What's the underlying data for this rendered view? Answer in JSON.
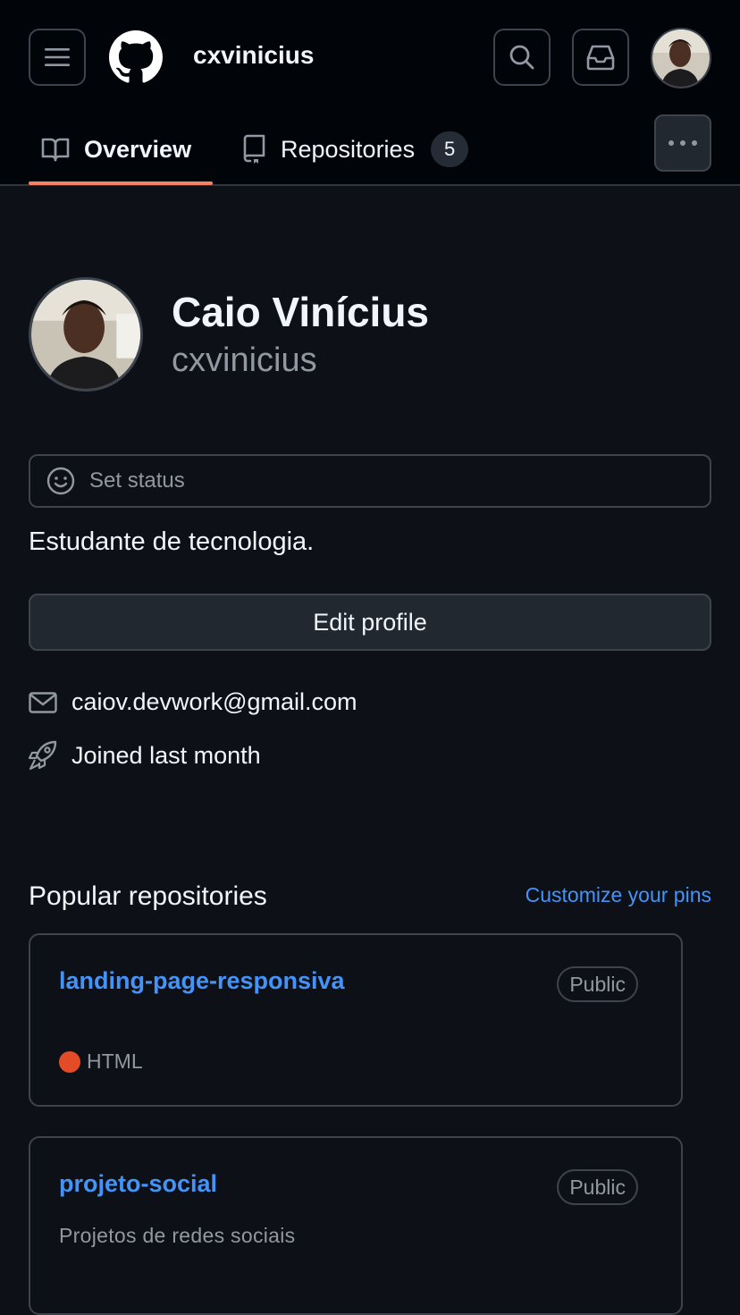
{
  "header": {
    "username": "cxvinicius",
    "tabs": [
      {
        "label": "Overview",
        "active": true
      },
      {
        "label": "Repositories",
        "count": "5"
      }
    ]
  },
  "profile": {
    "name": "Caio Vinícius",
    "login": "cxvinicius",
    "status_label": "Set status",
    "bio": "Estudante de tecnologia.",
    "edit_label": "Edit profile",
    "email": "caiov.devwork@gmail.com",
    "joined": "Joined last month"
  },
  "popular": {
    "title": "Popular repositories",
    "customize_label": "Customize your pins",
    "repos": [
      {
        "name": "landing-page-responsiva",
        "visibility": "Public",
        "language": "HTML",
        "language_color": "#e34c26"
      },
      {
        "name": "projeto-social",
        "visibility": "Public",
        "description": "Projetos de redes sociais"
      }
    ]
  },
  "colors": {
    "accent": "#4493f8",
    "tab_underline": "#f78166",
    "background": "#0d1117"
  }
}
